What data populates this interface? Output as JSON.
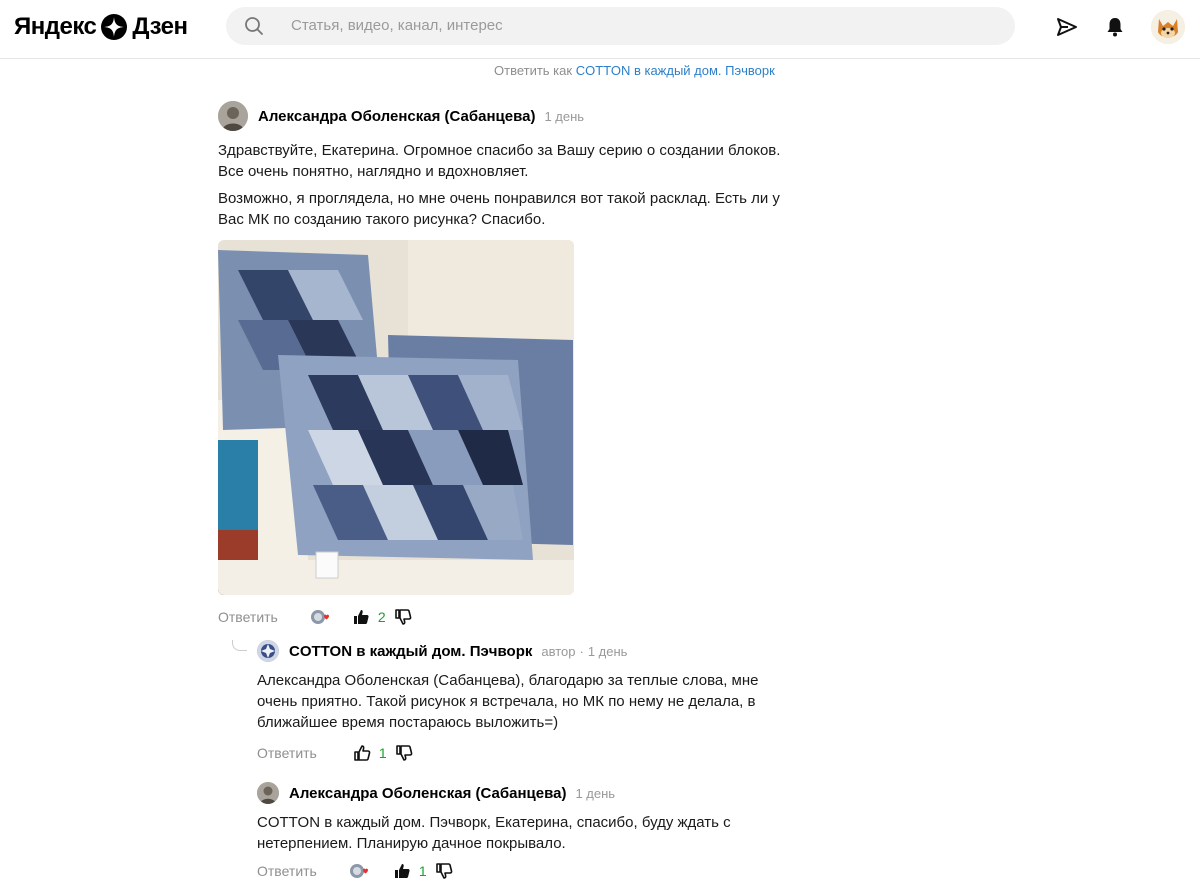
{
  "header": {
    "logo_part1": "Яндекс",
    "logo_part2": "Дзен",
    "search_placeholder": "Статья, видео, канал, интерес"
  },
  "reply_as": {
    "prefix": "Ответить как",
    "channel": "COTTON в каждый дом. Пэчворк"
  },
  "comments": [
    {
      "author": "Александра Оболенская (Сабанцева)",
      "time": "1 день",
      "paragraphs": [
        "Здравствуйте, Екатерина. Огромное спасибо за Вашу серию о создании блоков. Все очень понятно, наглядно и вдохновляет.",
        "Возможно, я проглядела, но мне очень понравился вот такой расклад. Есть ли у Вас МК по созданию такого рисунка? Спасибо."
      ],
      "reply_label": "Ответить",
      "likes": "2"
    },
    {
      "author": "COTTON в каждый дом. Пэчворк",
      "badge": "автор",
      "separator": "·",
      "time": "1 день",
      "text": "Александра Оболенская (Сабанцева), благодарю за теплые слова, мне очень приятно. Такой рисунок я встречала, но МК по нему не делала, в ближайшее время постараюсь выложить=)",
      "reply_label": "Ответить",
      "likes": "1"
    },
    {
      "author": "Александра Оболенская (Сабанцева)",
      "time": "1 день",
      "text": "COTTON в каждый дом. Пэчворк, Екатерина, спасибо, буду ждать с нетерпением. Планирую дачное покрывало.",
      "reply_label": "Ответить",
      "likes": "1"
    }
  ],
  "colors": {
    "link": "#2d7fc9",
    "like_count": "#1aa12e",
    "muted": "#8f8f8f"
  }
}
